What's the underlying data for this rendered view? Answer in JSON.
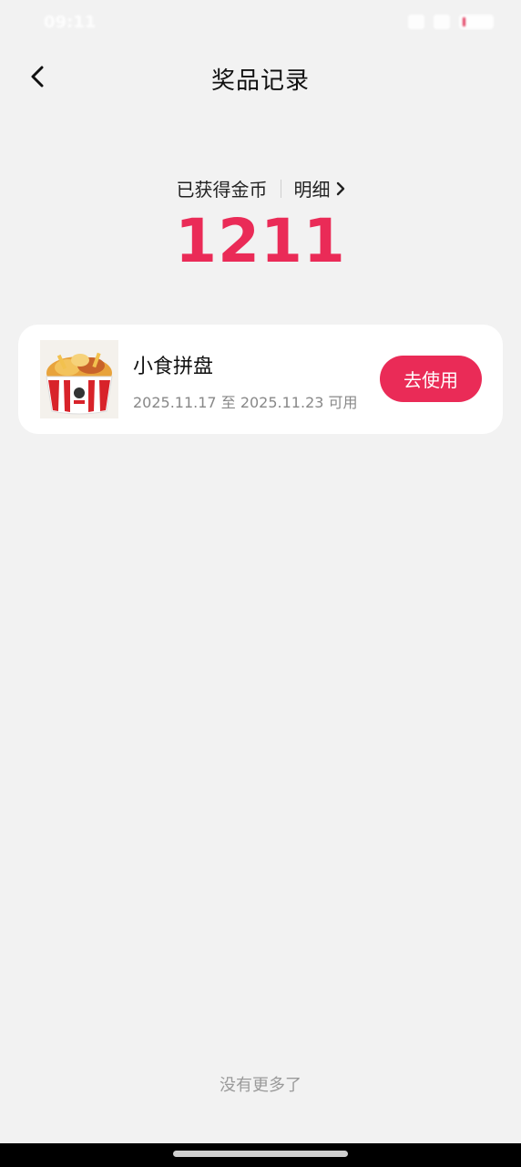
{
  "status_bar": {
    "time": "09:11"
  },
  "nav": {
    "title": "奖品记录",
    "back_icon": "chevron-left-icon"
  },
  "coins": {
    "label": "已获得金币",
    "detail_label": "明细",
    "detail_icon": "chevron-right-icon",
    "value": "1211",
    "accent_color": "#ea2b57"
  },
  "prizes": [
    {
      "name": "小食拼盘",
      "start_date": "2025.11.17",
      "range_word": "至",
      "end_date": "2025.11.23",
      "status": "可用",
      "action_label": "去使用",
      "image": "kfc-snack-bucket-image"
    }
  ],
  "footer": {
    "no_more": "没有更多了"
  }
}
